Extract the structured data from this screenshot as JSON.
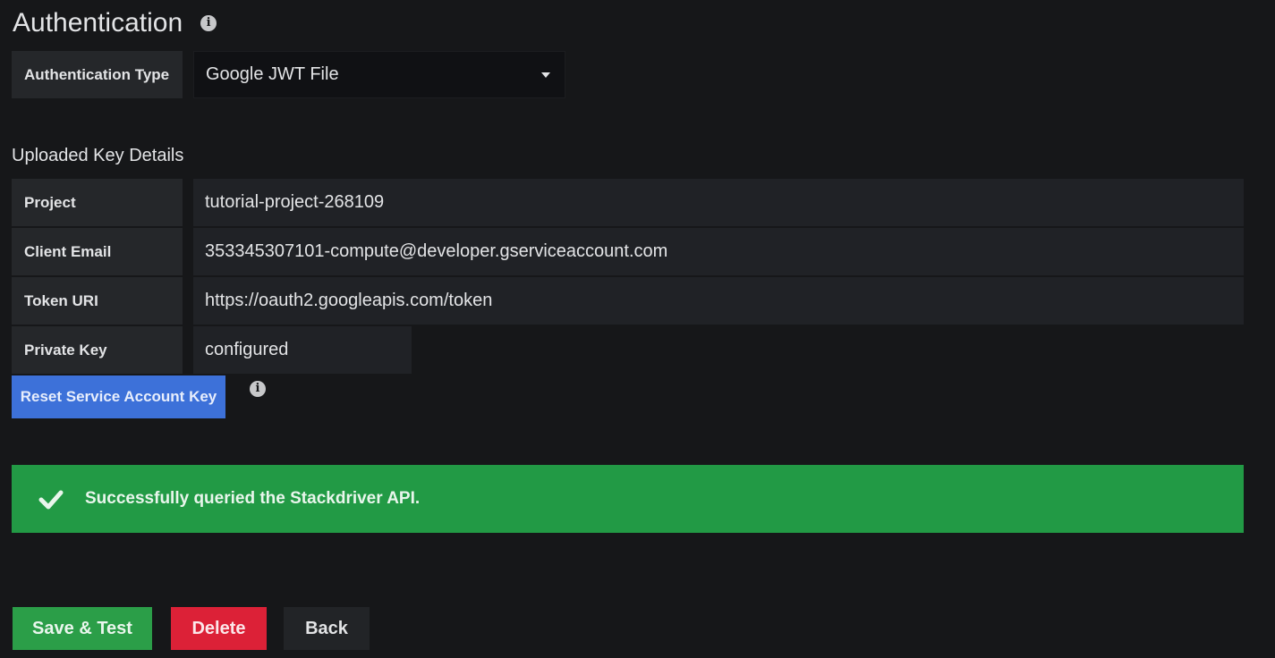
{
  "auth": {
    "title": "Authentication",
    "type_label": "Authentication Type",
    "type_value": "Google JWT File"
  },
  "key_details": {
    "section_title": "Uploaded Key Details",
    "fields": [
      {
        "label": "Project",
        "value": "tutorial-project-268109"
      },
      {
        "label": "Client Email",
        "value": "353345307101-compute@developer.gserviceaccount.com"
      },
      {
        "label": "Token URI",
        "value": "https://oauth2.googleapis.com/token"
      },
      {
        "label": "Private Key",
        "value": "configured"
      }
    ],
    "reset_label": "Reset Service Account Key"
  },
  "alert": {
    "message": "Successfully queried the Stackdriver API.",
    "icon": "check-icon"
  },
  "actions": {
    "save_label": "Save & Test",
    "delete_label": "Delete",
    "back_label": "Back"
  },
  "colors": {
    "background": "#161719",
    "reset_button": "#3d71d9",
    "success": "#229a45",
    "save_button": "#2b9e48",
    "delete_button": "#dc2137"
  },
  "icons": {
    "info": "info-icon",
    "caret": "chevron-down-icon"
  }
}
